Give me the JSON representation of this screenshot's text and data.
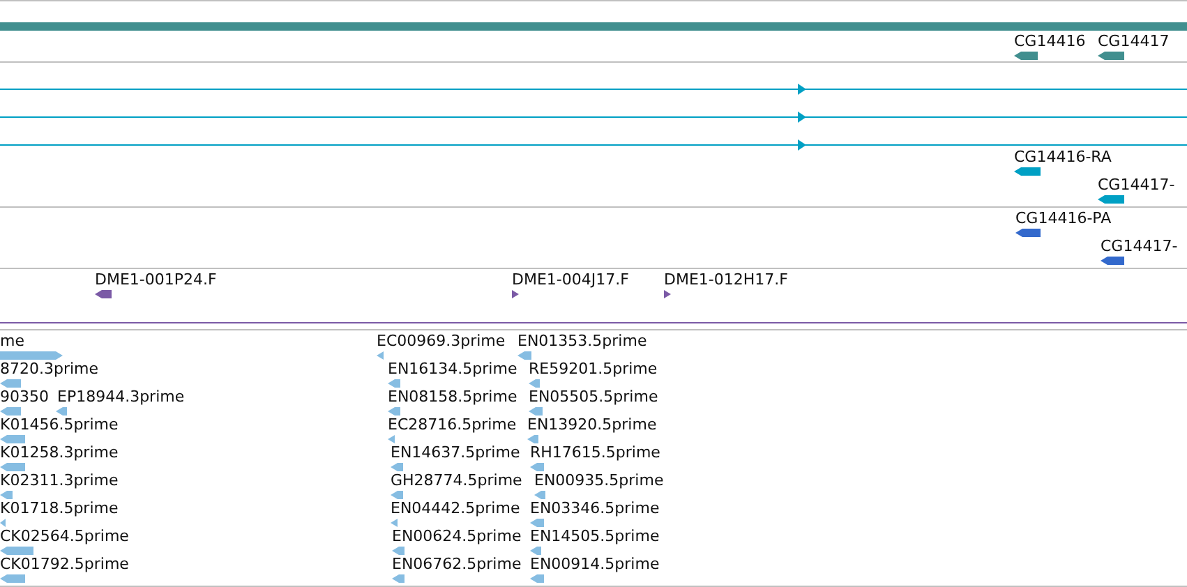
{
  "tracks": [
    {
      "kind": "genes",
      "features": [
        {
          "label": "CG14416",
          "reverse": true
        },
        {
          "label": "CG14417",
          "reverse": true
        }
      ]
    },
    {
      "kind": "transcripts",
      "features": [
        {
          "reverse": false
        },
        {
          "reverse": false
        },
        {
          "reverse": false
        },
        {
          "label": "CG14416-RA",
          "reverse": true
        },
        {
          "label": "CG14417-",
          "reverse": true
        }
      ]
    },
    {
      "kind": "proteins",
      "features": [
        {
          "label": "CG14416-PA",
          "reverse": true
        },
        {
          "label": "CG14417-",
          "reverse": true
        }
      ]
    },
    {
      "kind": "clones",
      "features": [
        {
          "label": "DME1-001P24.F",
          "reverse": true
        },
        {
          "label": "DME1-004J17.F",
          "reverse": false
        },
        {
          "label": "DME1-012H17.F",
          "reverse": false
        }
      ]
    },
    {
      "kind": "ests",
      "features": [
        {
          "label": "me",
          "reverse": false
        },
        {
          "label": "EC00969.3prime",
          "reverse": true
        },
        {
          "label": "EN01353.5prime",
          "reverse": true
        },
        {
          "label": "8720.3prime",
          "reverse": true
        },
        {
          "label": "EN16134.5prime",
          "reverse": true
        },
        {
          "label": "RE59201.5prime",
          "reverse": true
        },
        {
          "label": "90350",
          "reverse": true
        },
        {
          "label": "EP18944.3prime",
          "reverse": true
        },
        {
          "label": "EN08158.5prime",
          "reverse": true
        },
        {
          "label": "EN05505.5prime",
          "reverse": true
        },
        {
          "label": "K01456.5prime",
          "reverse": true
        },
        {
          "label": "EC28716.5prime",
          "reverse": true
        },
        {
          "label": "EN13920.5prime",
          "reverse": true
        },
        {
          "label": "K01258.3prime",
          "reverse": true
        },
        {
          "label": "EN14637.5prime",
          "reverse": true
        },
        {
          "label": "RH17615.5prime",
          "reverse": true
        },
        {
          "label": "K02311.3prime",
          "reverse": true
        },
        {
          "label": "GH28774.5prime",
          "reverse": true
        },
        {
          "label": "EN00935.5prime",
          "reverse": true
        },
        {
          "label": "K01718.5prime",
          "reverse": true
        },
        {
          "label": "EN04442.5prime",
          "reverse": true
        },
        {
          "label": "EN03346.5prime",
          "reverse": true
        },
        {
          "label": "CK02564.5prime",
          "reverse": true
        },
        {
          "label": "EN00624.5prime",
          "reverse": true
        },
        {
          "label": "EN14505.5prime",
          "reverse": true
        },
        {
          "label": "CK01792.5prime",
          "reverse": true
        },
        {
          "label": "EN06762.5prime",
          "reverse": true
        },
        {
          "label": "EN00914.5prime",
          "reverse": true
        }
      ]
    }
  ]
}
